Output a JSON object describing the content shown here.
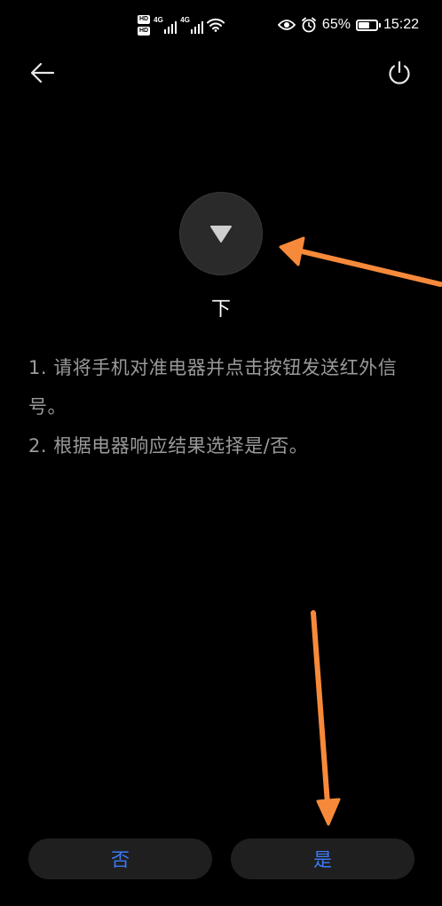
{
  "status_bar": {
    "hd_label_1": "HD",
    "hd_label_2": "HD",
    "sim1_tag": "4G",
    "sim2_tag": "4G",
    "battery_text": "65%",
    "battery_level": 0.65,
    "time": "15:22",
    "icons": [
      "eye-icon",
      "alarm-icon",
      "wifi-icon",
      "battery-icon",
      "signal-icon"
    ]
  },
  "nav": {
    "back_icon": "back-arrow-icon",
    "power_icon": "power-icon"
  },
  "key": {
    "icon": "triangle-down-icon",
    "label": "下"
  },
  "instructions": {
    "line1": "1. 请将手机对准电器并点击按钮发送红外信号。",
    "line2": "2. 根据电器响应结果选择是/否。"
  },
  "buttons": {
    "no_label": "否",
    "yes_label": "是"
  },
  "colors": {
    "background": "#000000",
    "accent": "#3b7bf7",
    "annotation": "#f68a3a"
  }
}
